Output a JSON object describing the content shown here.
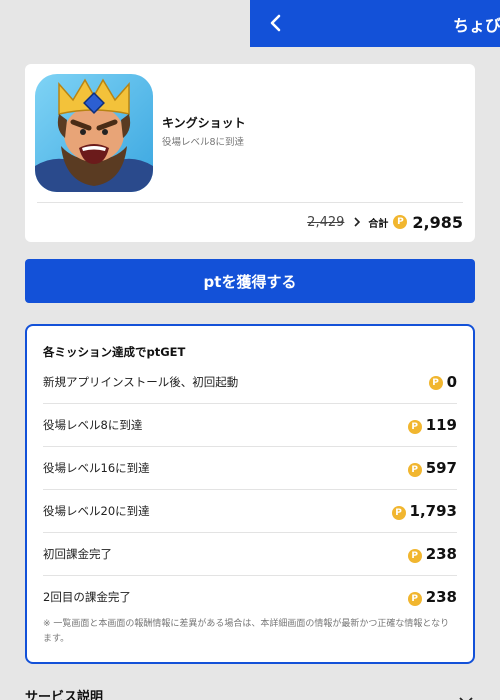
{
  "header": {
    "title": "ちょび",
    "back_icon": "chevron-left-icon"
  },
  "app": {
    "name": "キングショット",
    "subtitle": "役場レベル8に到達",
    "old_price": "2,429",
    "total_label": "合計",
    "total_value": "2,985",
    "coin_symbol": "P"
  },
  "cta": {
    "label": "ptを獲得する"
  },
  "missions": {
    "title": "各ミッション達成でptGET",
    "items": [
      {
        "label": "新規アプリインストール後、初回起動",
        "value": "0"
      },
      {
        "label": "役場レベル8に到達",
        "value": "119"
      },
      {
        "label": "役場レベル16に到達",
        "value": "597"
      },
      {
        "label": "役場レベル20に到達",
        "value": "1,793"
      },
      {
        "label": "初回課金完了",
        "value": "238"
      },
      {
        "label": "2回目の課金完了",
        "value": "238"
      }
    ],
    "note": "※ 一覧画面と本画面の報酬情報に差異がある場合は、本詳細画面の情報が最新かつ正確な情報となります。"
  },
  "service": {
    "title": "サービス説明"
  },
  "colors": {
    "brand_blue": "#1351d8",
    "coin": "#f1b62f",
    "background": "#e6e6e6"
  }
}
